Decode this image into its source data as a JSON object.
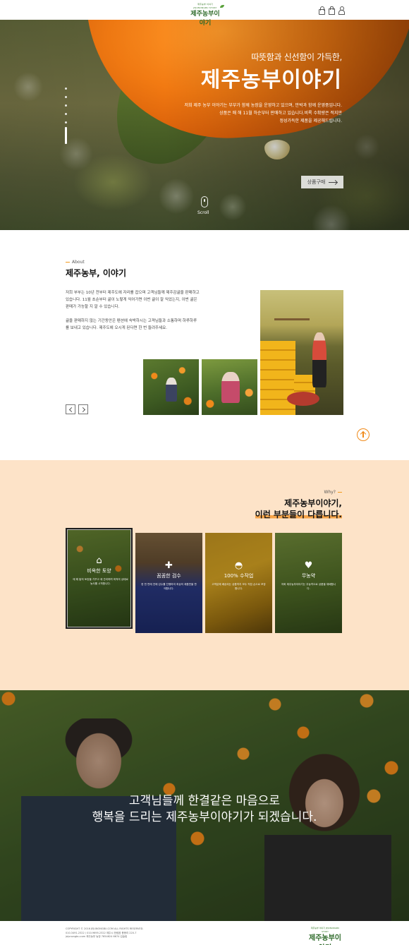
{
  "header": {
    "logo_tagline": "제주농부 이야기 JEJUNONGBU STORY",
    "logo_text": "제주농부이야기",
    "icons": [
      "lock-icon",
      "bag-icon",
      "user-icon"
    ]
  },
  "hero": {
    "subtitle": "따뜻함과 신선함이 가득한,",
    "title": "제주농부이야기",
    "desc": [
      "저희 제주 농부 이야기는 부부가 함께 농장을 운영하고 있으며, 만박과 함께 운영중입니다.",
      "상품은 매 해 11월 하순부터 판매하고 있습니다.비록 수확량은 적지만",
      "정성가득한 제품을 제공해드립니다."
    ],
    "cta_label": "상품구매",
    "scroll_label": "Scroll"
  },
  "about": {
    "eyebrow": "About",
    "title": "제주농부, 이야기",
    "paragraphs": [
      "저희 부부는 10년 전부터 제주도에 자리를 잡으며 고객님들께 제주감귤을 판매하고 있습니다. 11월 초순부터 귤이 노랗게 익어가면 이번 귤이 잘 익었는지, 이번 귤은 판매가 가능할 지 알 수 있습니다.",
      "귤을 판매하지 않는 기간동안은 펜션에 숙박하시는 고객님들과 소통하며 하루하루를 보내고 있습니다. 제주도에 오시게 된다면 한 번 들려주세요."
    ]
  },
  "why": {
    "eyebrow": "Why?",
    "title_line1": "제주농부이야기,",
    "title_line2": "이런 부분들이 다릅니다.",
    "cards": [
      {
        "title": "비옥한 토양",
        "text": "매 해 밭의 토양을 가꾸고 제 관리하며 최적의 상태로 농사를 시작합니다.",
        "icon": "pot-icon",
        "glyph": "⌂"
      },
      {
        "title": "꼼꼼한 검수",
        "text": "한 번 판매 전에 감수를 진행하여 최상의 제품만을 판매합니다.",
        "icon": "plus-icon",
        "glyph": "✚"
      },
      {
        "title": "100% 수작업",
        "text": "고객분께 배송되는 상품까지 모두 직접 손으로 포장합니다.",
        "icon": "hat-icon",
        "glyph": "◓"
      },
      {
        "title": "무농약",
        "text": "저희 제주농부이야기는 무농약으로 상품을 재배합니다.",
        "icon": "heart-icon",
        "glyph": "♥"
      }
    ]
  },
  "banner": {
    "line1": "고객님들께 한결같은 마음으로",
    "line2": "행복을 드리는 제주농부이야기가 되겠습니다."
  },
  "footer": {
    "lines": [
      "COPYRIGHT © 2016 JEJUNONGBU.COM ALL RIGHTS RESERVED.",
      "010.3491.2322 / 010.9695.2322 제주시 한림읍 용봉리 220-7",
      "jejunongbu.com 제주농부 농장 7654624 6674 김슬림"
    ],
    "logo_text": "제주농부이야기"
  },
  "colors": {
    "accent": "#f39a1e",
    "why_bg": "#fde3c8",
    "logo_green": "#2f6b2b"
  }
}
